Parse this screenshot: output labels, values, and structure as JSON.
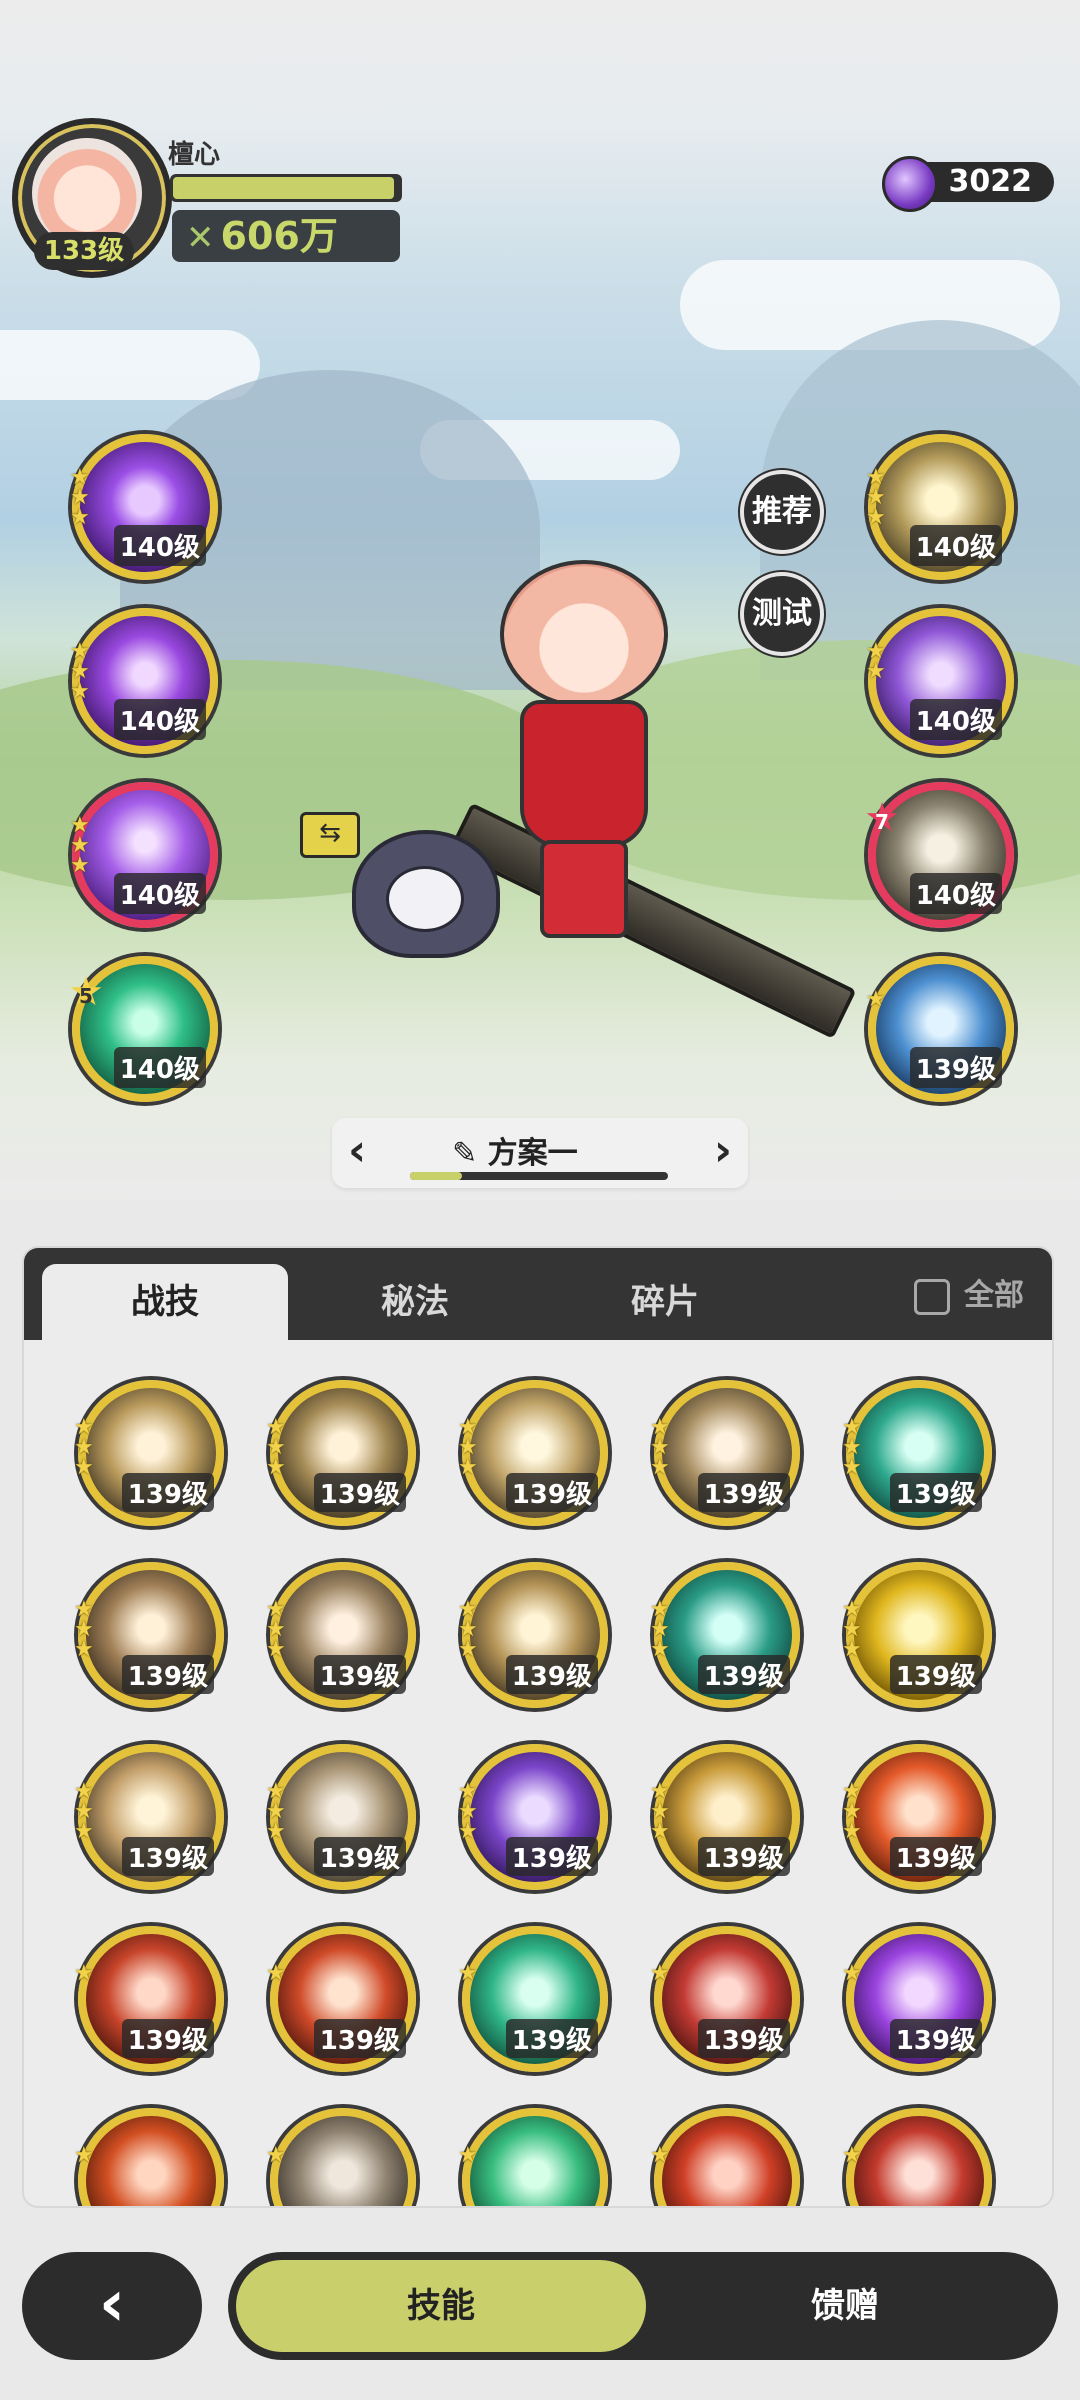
{
  "player": {
    "name": "檀心",
    "level": "133级",
    "hp_fraction": 0.98,
    "power": "606万"
  },
  "currency": {
    "icon": "purple-gem-icon",
    "amount": "3022"
  },
  "side_buttons": {
    "recommend": "推荐",
    "test": "测试"
  },
  "left_skills": [
    {
      "level": "140级",
      "stars": 3,
      "icon": "purple-heart-vortex-icon"
    },
    {
      "level": "140级",
      "stars": 3,
      "icon": "purple-spirits-icon"
    },
    {
      "level": "140级",
      "stars": 3,
      "icon": "purple-roses-icon"
    },
    {
      "level": "140级",
      "star_badge": "5",
      "icon": "green-cyclone-icon"
    }
  ],
  "right_skills": [
    {
      "level": "140级",
      "stars": 3,
      "icon": "golden-eye-icon"
    },
    {
      "level": "140级",
      "stars": 2,
      "icon": "purple-orb-icon"
    },
    {
      "level": "140级",
      "star_badge": "7",
      "icon": "figure-slash-icon"
    },
    {
      "level": "139级",
      "stars": 1,
      "icon": "blue-crystal-icon"
    }
  ],
  "plan": {
    "prev": "‹",
    "next": "›",
    "edit_icon": "pencil-icon",
    "title": "方案一",
    "progress": 0.2
  },
  "tabs": {
    "skills": "战技",
    "arcana": "秘法",
    "fragments": "碎片",
    "all": "全部"
  },
  "skill_grid": [
    {
      "level": "139级",
      "icon": "wind-slash-icon"
    },
    {
      "level": "139级",
      "icon": "crescent-strike-icon"
    },
    {
      "level": "139级",
      "icon": "sword-burst-icon"
    },
    {
      "level": "139级",
      "icon": "feather-slash-icon"
    },
    {
      "level": "139级",
      "icon": "teal-dash-icon"
    },
    {
      "level": "139级",
      "icon": "spike-blast-icon"
    },
    {
      "level": "139级",
      "icon": "dancer-icon"
    },
    {
      "level": "139级",
      "icon": "light-streak-icon"
    },
    {
      "level": "139级",
      "icon": "web-icon"
    },
    {
      "level": "139级",
      "icon": "gold-crystal-icon"
    },
    {
      "level": "139级",
      "icon": "explosion-icon"
    },
    {
      "level": "139级",
      "icon": "dust-cloud-icon"
    },
    {
      "level": "139级",
      "icon": "purple-claw-icon"
    },
    {
      "level": "139级",
      "icon": "golden-ring-icon"
    },
    {
      "level": "139级",
      "icon": "fire-figure-icon"
    },
    {
      "level": "139级",
      "icon": "red-arc-icon"
    },
    {
      "level": "139级",
      "icon": "red-emblem-icon"
    },
    {
      "level": "139级",
      "icon": "green-sword-icon"
    },
    {
      "level": "139级",
      "icon": "red-warrior-icon"
    },
    {
      "level": "139级",
      "icon": "purple-flame-icon"
    },
    {
      "level": "",
      "icon": "fire-swirl-icon"
    },
    {
      "level": "",
      "icon": "shadow-hand-icon"
    },
    {
      "level": "",
      "icon": "green-arrows-icon"
    },
    {
      "level": "",
      "icon": "fire-ring-icon"
    },
    {
      "level": "",
      "icon": "red-spark-icon"
    }
  ],
  "bottom_nav": {
    "back": "‹",
    "skills": "技能",
    "gifts": "馈赠"
  },
  "colors": {
    "gold_ring": "#e4c23a",
    "accent_green": "#c9cf6a",
    "red_ring": "#e43b5e",
    "dark": "#2c2c2c"
  }
}
